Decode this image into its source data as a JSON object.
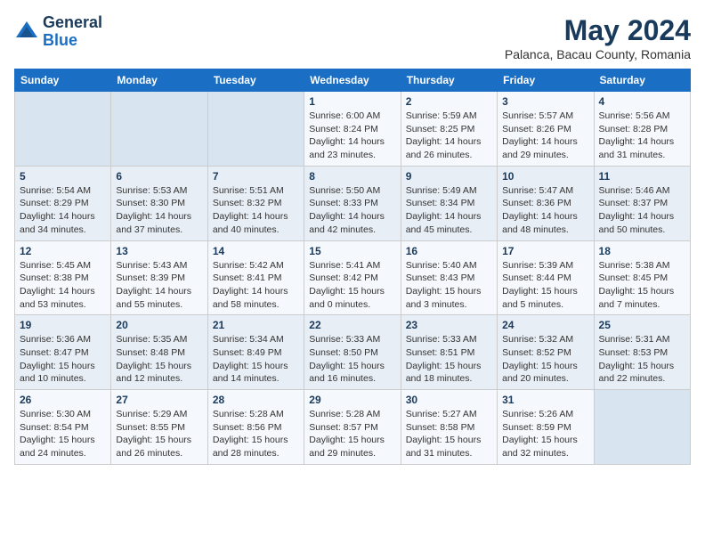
{
  "logo": {
    "general": "General",
    "blue": "Blue"
  },
  "header": {
    "month": "May 2024",
    "location": "Palanca, Bacau County, Romania"
  },
  "weekdays": [
    "Sunday",
    "Monday",
    "Tuesday",
    "Wednesday",
    "Thursday",
    "Friday",
    "Saturday"
  ],
  "weeks": [
    [
      {
        "day": "",
        "info": ""
      },
      {
        "day": "",
        "info": ""
      },
      {
        "day": "",
        "info": ""
      },
      {
        "day": "1",
        "info": "Sunrise: 6:00 AM\nSunset: 8:24 PM\nDaylight: 14 hours\nand 23 minutes."
      },
      {
        "day": "2",
        "info": "Sunrise: 5:59 AM\nSunset: 8:25 PM\nDaylight: 14 hours\nand 26 minutes."
      },
      {
        "day": "3",
        "info": "Sunrise: 5:57 AM\nSunset: 8:26 PM\nDaylight: 14 hours\nand 29 minutes."
      },
      {
        "day": "4",
        "info": "Sunrise: 5:56 AM\nSunset: 8:28 PM\nDaylight: 14 hours\nand 31 minutes."
      }
    ],
    [
      {
        "day": "5",
        "info": "Sunrise: 5:54 AM\nSunset: 8:29 PM\nDaylight: 14 hours\nand 34 minutes."
      },
      {
        "day": "6",
        "info": "Sunrise: 5:53 AM\nSunset: 8:30 PM\nDaylight: 14 hours\nand 37 minutes."
      },
      {
        "day": "7",
        "info": "Sunrise: 5:51 AM\nSunset: 8:32 PM\nDaylight: 14 hours\nand 40 minutes."
      },
      {
        "day": "8",
        "info": "Sunrise: 5:50 AM\nSunset: 8:33 PM\nDaylight: 14 hours\nand 42 minutes."
      },
      {
        "day": "9",
        "info": "Sunrise: 5:49 AM\nSunset: 8:34 PM\nDaylight: 14 hours\nand 45 minutes."
      },
      {
        "day": "10",
        "info": "Sunrise: 5:47 AM\nSunset: 8:36 PM\nDaylight: 14 hours\nand 48 minutes."
      },
      {
        "day": "11",
        "info": "Sunrise: 5:46 AM\nSunset: 8:37 PM\nDaylight: 14 hours\nand 50 minutes."
      }
    ],
    [
      {
        "day": "12",
        "info": "Sunrise: 5:45 AM\nSunset: 8:38 PM\nDaylight: 14 hours\nand 53 minutes."
      },
      {
        "day": "13",
        "info": "Sunrise: 5:43 AM\nSunset: 8:39 PM\nDaylight: 14 hours\nand 55 minutes."
      },
      {
        "day": "14",
        "info": "Sunrise: 5:42 AM\nSunset: 8:41 PM\nDaylight: 14 hours\nand 58 minutes."
      },
      {
        "day": "15",
        "info": "Sunrise: 5:41 AM\nSunset: 8:42 PM\nDaylight: 15 hours\nand 0 minutes."
      },
      {
        "day": "16",
        "info": "Sunrise: 5:40 AM\nSunset: 8:43 PM\nDaylight: 15 hours\nand 3 minutes."
      },
      {
        "day": "17",
        "info": "Sunrise: 5:39 AM\nSunset: 8:44 PM\nDaylight: 15 hours\nand 5 minutes."
      },
      {
        "day": "18",
        "info": "Sunrise: 5:38 AM\nSunset: 8:45 PM\nDaylight: 15 hours\nand 7 minutes."
      }
    ],
    [
      {
        "day": "19",
        "info": "Sunrise: 5:36 AM\nSunset: 8:47 PM\nDaylight: 15 hours\nand 10 minutes."
      },
      {
        "day": "20",
        "info": "Sunrise: 5:35 AM\nSunset: 8:48 PM\nDaylight: 15 hours\nand 12 minutes."
      },
      {
        "day": "21",
        "info": "Sunrise: 5:34 AM\nSunset: 8:49 PM\nDaylight: 15 hours\nand 14 minutes."
      },
      {
        "day": "22",
        "info": "Sunrise: 5:33 AM\nSunset: 8:50 PM\nDaylight: 15 hours\nand 16 minutes."
      },
      {
        "day": "23",
        "info": "Sunrise: 5:33 AM\nSunset: 8:51 PM\nDaylight: 15 hours\nand 18 minutes."
      },
      {
        "day": "24",
        "info": "Sunrise: 5:32 AM\nSunset: 8:52 PM\nDaylight: 15 hours\nand 20 minutes."
      },
      {
        "day": "25",
        "info": "Sunrise: 5:31 AM\nSunset: 8:53 PM\nDaylight: 15 hours\nand 22 minutes."
      }
    ],
    [
      {
        "day": "26",
        "info": "Sunrise: 5:30 AM\nSunset: 8:54 PM\nDaylight: 15 hours\nand 24 minutes."
      },
      {
        "day": "27",
        "info": "Sunrise: 5:29 AM\nSunset: 8:55 PM\nDaylight: 15 hours\nand 26 minutes."
      },
      {
        "day": "28",
        "info": "Sunrise: 5:28 AM\nSunset: 8:56 PM\nDaylight: 15 hours\nand 28 minutes."
      },
      {
        "day": "29",
        "info": "Sunrise: 5:28 AM\nSunset: 8:57 PM\nDaylight: 15 hours\nand 29 minutes."
      },
      {
        "day": "30",
        "info": "Sunrise: 5:27 AM\nSunset: 8:58 PM\nDaylight: 15 hours\nand 31 minutes."
      },
      {
        "day": "31",
        "info": "Sunrise: 5:26 AM\nSunset: 8:59 PM\nDaylight: 15 hours\nand 32 minutes."
      },
      {
        "day": "",
        "info": ""
      }
    ]
  ]
}
